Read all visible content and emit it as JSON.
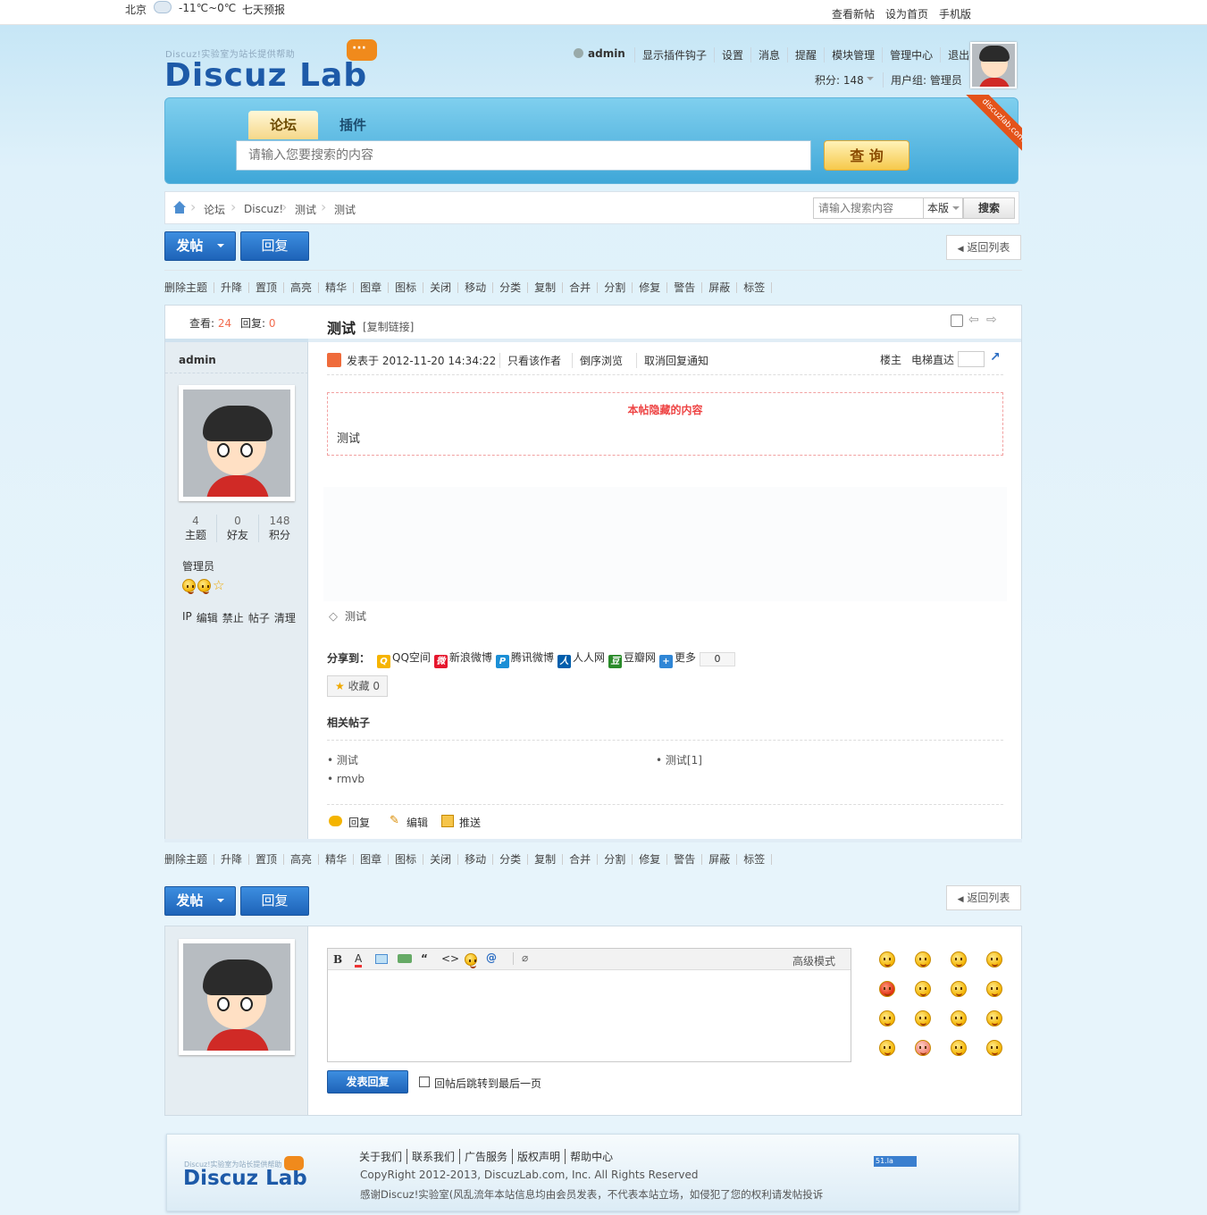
{
  "topbar": {
    "city": "北京",
    "temp": "-11℃~0℃",
    "forecast": "七天预报",
    "links": [
      "查看新帖",
      "设为首页",
      "手机版"
    ]
  },
  "logo": {
    "tagline": "Discuz!实验室为站长提供帮助",
    "text": "Discuz Lab"
  },
  "user": {
    "name": "admin",
    "links": [
      "显示插件钩子",
      "设置",
      "消息",
      "提醒",
      "模块管理",
      "管理中心",
      "退出"
    ],
    "points_label": "积分: 148",
    "group_label": "用户组: 管理员"
  },
  "ribbon": "discuzlab.com",
  "search": {
    "tabs": [
      "论坛",
      "插件"
    ],
    "placeholder": "请输入您要搜索的内容",
    "button": "查 询"
  },
  "breadcrumb": {
    "items": [
      "论坛",
      "Discuz!",
      "测试",
      "测试"
    ],
    "search_placeholder": "请输入搜索内容",
    "scope": "本版",
    "search_btn": "搜索"
  },
  "actions": {
    "post": "发帖",
    "reply": "回复",
    "back": "返回列表"
  },
  "modtools": [
    "删除主题",
    "升降",
    "置顶",
    "高亮",
    "精华",
    "图章",
    "图标",
    "关闭",
    "移动",
    "分类",
    "复制",
    "合并",
    "分割",
    "修复",
    "警告",
    "屏蔽",
    "标签"
  ],
  "stats": {
    "views_label": "查看:",
    "views": "24",
    "replies_label": "回复:",
    "replies": "0"
  },
  "thread": {
    "title": "测试",
    "copy_link": "[复制链接]"
  },
  "author": {
    "name": "admin",
    "threads": "4",
    "threads_label": "主题",
    "friends": "0",
    "friends_label": "好友",
    "points": "148",
    "points_label": "积分",
    "group": "管理员",
    "admin_links": [
      "IP",
      "编辑",
      "禁止",
      "帖子",
      "清理"
    ]
  },
  "post": {
    "posted_at": "发表于  2012-11-20 14:34:22",
    "only_author": "只看该作者",
    "reverse": "倒序浏览",
    "cancel_notify": "取消回复通知",
    "floor": "楼主",
    "elevator": "电梯直达",
    "hidden_title": "本帖隐藏的内容",
    "hidden_body": "测试",
    "tag": "测试"
  },
  "share": {
    "label": "分享到：",
    "items": [
      {
        "name": "QQ空间",
        "color": "#f6b400",
        "icon": "Q"
      },
      {
        "name": "新浪微博",
        "color": "#e6162d",
        "icon": "微"
      },
      {
        "name": "腾讯微博",
        "color": "#1b8fd6",
        "icon": "P"
      },
      {
        "name": "人人网",
        "color": "#005eac",
        "icon": "人"
      },
      {
        "name": "豆瓣网",
        "color": "#2a8b2a",
        "icon": "豆"
      },
      {
        "name": "更多",
        "color": "#2f86d6",
        "icon": "+"
      }
    ],
    "count": "0"
  },
  "favorite": "收藏 0",
  "related": {
    "title": "相关帖子",
    "items": [
      "测试",
      "测试[1]",
      "rmvb"
    ]
  },
  "post_actions": [
    "回复",
    "编辑",
    "推送"
  ],
  "editor": {
    "advanced": "高级模式",
    "submit": "发表回复",
    "jump_label": "回帖后跳转到最后一页"
  },
  "footer": {
    "links": [
      "关于我们",
      "联系我们",
      "广告服务",
      "版权声明",
      "帮助中心"
    ],
    "copyright": "CopyRight 2012-2013, DiscuzLab.com, Inc. All Rights Reserved",
    "disclaimer": "感谢Discuz!实验室(风乱流年本站信息均由会员发表，不代表本站立场，如侵犯了您的权利请发帖投诉",
    "badge": "51.la"
  }
}
